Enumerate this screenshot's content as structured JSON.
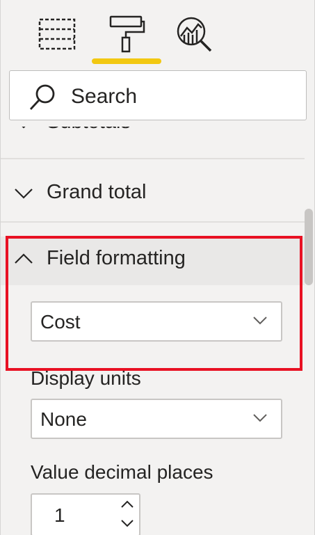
{
  "tabs": [
    {
      "name": "fields",
      "icon": "table-icon",
      "active": false
    },
    {
      "name": "format",
      "icon": "paint-roller-icon",
      "active": true
    },
    {
      "name": "analytics",
      "icon": "analytics-magnifier-icon",
      "active": false
    }
  ],
  "accent_color": "#f2c811",
  "highlight_color": "#e81123",
  "search": {
    "label": "Search",
    "icon": "search-icon"
  },
  "sections": {
    "subtotals": "Subtotals",
    "grand_total": "Grand total",
    "field_formatting": "Field formatting"
  },
  "field_formatting": {
    "field_select": {
      "value": "Cost"
    },
    "display_units": {
      "label": "Display units",
      "value": "None"
    },
    "decimal_places": {
      "label": "Value decimal places",
      "value": "1"
    }
  }
}
